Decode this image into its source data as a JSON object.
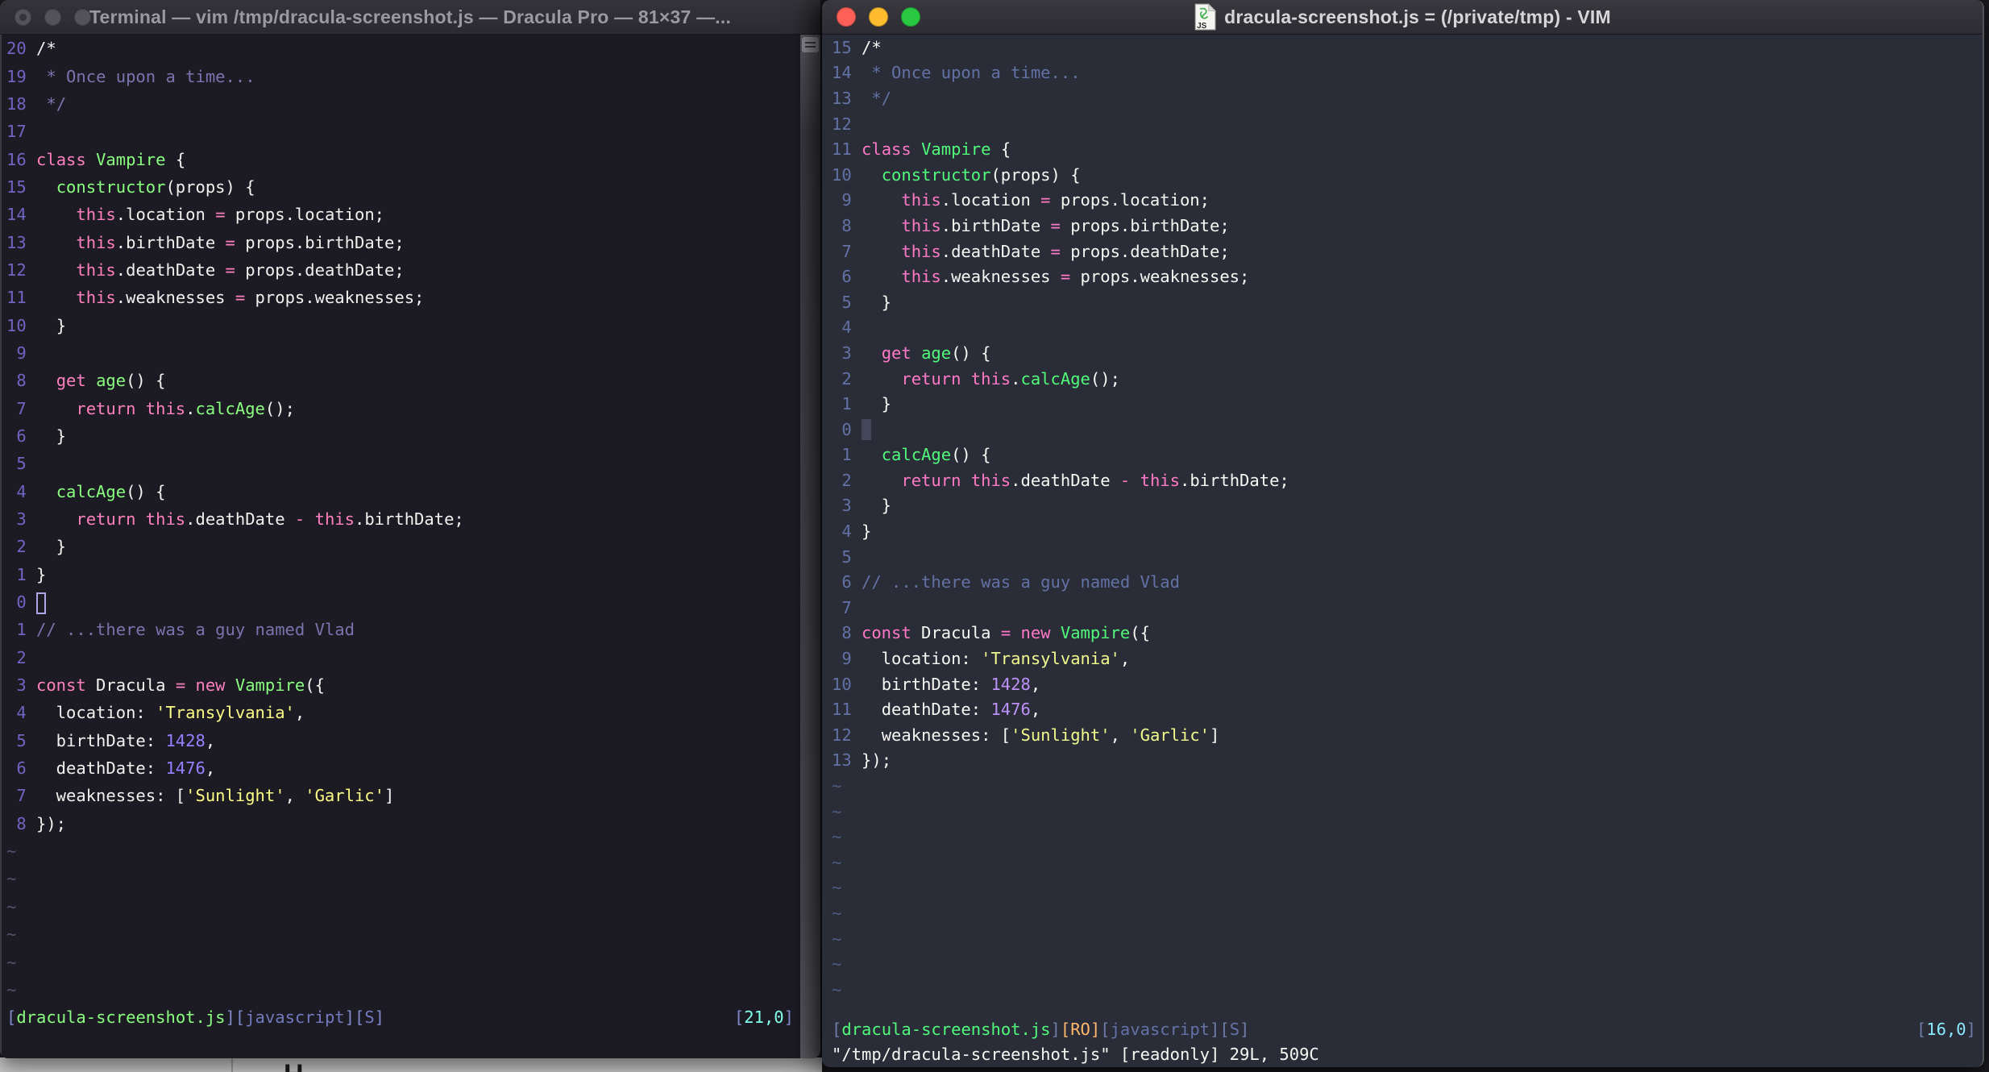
{
  "left_window": {
    "title": "Terminal — vim /tmp/dracula-screenshot.js — Dracula Pro — 81×37 —...",
    "traffic_lights": [
      "close",
      "minimize",
      "zoom"
    ],
    "line_numbers": [
      "20",
      "19",
      "18",
      "17",
      "16",
      "15",
      "14",
      "13",
      "12",
      "11",
      "10",
      "9",
      "8",
      "7",
      "6",
      "5",
      "4",
      "3",
      "2",
      "1",
      "0",
      "1",
      "2",
      "3",
      "4",
      "5",
      "6",
      "7",
      "8"
    ],
    "tilde_rows": 6,
    "cursor_row_index": 20,
    "cursor_style": "hollow",
    "status_left_spans": [
      [
        "sb",
        "["
      ],
      [
        "sfile",
        "dracula-screenshot.js"
      ],
      [
        "sb",
        "]["
      ],
      [
        "sflag",
        "javascript"
      ],
      [
        "sb",
        "]["
      ],
      [
        "sflag",
        "S"
      ],
      [
        "sb",
        "]"
      ]
    ],
    "status_right_spans": [
      [
        "sb",
        "["
      ],
      [
        "spos",
        "21,0"
      ],
      [
        "sb",
        "]"
      ]
    ],
    "command_line": "",
    "palette": {
      "background": "#1c1b24",
      "foreground": "#f2f1ee",
      "comment": "#7a74ae",
      "pink": "#ff80bf",
      "green": "#8aff80",
      "purple": "#9580ff",
      "yellow": "#fdfd85",
      "cyan": "#80ffea",
      "line_number": "#7064c2"
    }
  },
  "right_window": {
    "title": "dracula-screenshot.js = (/private/tmp) - VIM",
    "doc_icon_label": "JS",
    "traffic_lights": [
      "close",
      "minimize",
      "zoom"
    ],
    "line_numbers": [
      "15",
      "14",
      "13",
      "12",
      "11",
      "10",
      "9",
      "8",
      "7",
      "6",
      "5",
      "4",
      "3",
      "2",
      "1",
      "0",
      "1",
      "2",
      "3",
      "4",
      "5",
      "6",
      "7",
      "8",
      "9",
      "10",
      "11",
      "12",
      "13"
    ],
    "tilde_rows": 9,
    "cursor_row_index": 15,
    "cursor_style": "block",
    "status_left_spans": [
      [
        "sb",
        "["
      ],
      [
        "sfile",
        "dracula-screenshot.js"
      ],
      [
        "sb",
        "]"
      ],
      [
        "sro",
        "[RO]"
      ],
      [
        "sb",
        "["
      ],
      [
        "sflag",
        "javascript"
      ],
      [
        "sb",
        "]["
      ],
      [
        "sflag",
        "S"
      ],
      [
        "sb",
        "]"
      ]
    ],
    "status_right_spans": [
      [
        "sb",
        "["
      ],
      [
        "spos",
        "16,0"
      ],
      [
        "sb",
        "]"
      ]
    ],
    "command_line": "\"/tmp/dracula-screenshot.js\" [readonly] 29L, 509C",
    "palette": {
      "background": "#2a2c38",
      "foreground": "#f8f8f2",
      "comment": "#6272a4",
      "pink": "#ff79c6",
      "green": "#50fa7b",
      "purple": "#bd93f9",
      "yellow": "#f1fa8c",
      "cyan": "#8be9fd",
      "orange": "#ffb86c",
      "line_number": "#6272a4"
    }
  },
  "code_lines": [
    {
      "spans": [
        [
          "fg",
          "/*"
        ]
      ]
    },
    {
      "spans": [
        [
          "comment",
          " * Once upon a time..."
        ]
      ]
    },
    {
      "spans": [
        [
          "comment",
          " */"
        ]
      ]
    },
    {
      "spans": []
    },
    {
      "spans": [
        [
          "pink",
          "class"
        ],
        [
          "fg",
          " "
        ],
        [
          "green",
          "Vampire"
        ],
        [
          "fg",
          " {"
        ]
      ]
    },
    {
      "spans": [
        [
          "fg",
          "  "
        ],
        [
          "green",
          "constructor"
        ],
        [
          "fg",
          "(props) {"
        ]
      ]
    },
    {
      "spans": [
        [
          "fg",
          "    "
        ],
        [
          "pink",
          "this"
        ],
        [
          "fg",
          ".location "
        ],
        [
          "pink",
          "="
        ],
        [
          "fg",
          " props.location;"
        ]
      ]
    },
    {
      "spans": [
        [
          "fg",
          "    "
        ],
        [
          "pink",
          "this"
        ],
        [
          "fg",
          ".birthDate "
        ],
        [
          "pink",
          "="
        ],
        [
          "fg",
          " props.birthDate;"
        ]
      ]
    },
    {
      "spans": [
        [
          "fg",
          "    "
        ],
        [
          "pink",
          "this"
        ],
        [
          "fg",
          ".deathDate "
        ],
        [
          "pink",
          "="
        ],
        [
          "fg",
          " props.deathDate;"
        ]
      ]
    },
    {
      "spans": [
        [
          "fg",
          "    "
        ],
        [
          "pink",
          "this"
        ],
        [
          "fg",
          ".weaknesses "
        ],
        [
          "pink",
          "="
        ],
        [
          "fg",
          " props.weaknesses;"
        ]
      ]
    },
    {
      "spans": [
        [
          "fg",
          "  }"
        ]
      ]
    },
    {
      "spans": []
    },
    {
      "spans": [
        [
          "fg",
          "  "
        ],
        [
          "pink",
          "get"
        ],
        [
          "fg",
          " "
        ],
        [
          "green",
          "age"
        ],
        [
          "fg",
          "() {"
        ]
      ]
    },
    {
      "spans": [
        [
          "fg",
          "    "
        ],
        [
          "pink",
          "return"
        ],
        [
          "fg",
          " "
        ],
        [
          "pink",
          "this"
        ],
        [
          "fg",
          "."
        ],
        [
          "green",
          "calcAge"
        ],
        [
          "fg",
          "();"
        ]
      ]
    },
    {
      "spans": [
        [
          "fg",
          "  }"
        ]
      ]
    },
    {
      "spans": []
    },
    {
      "spans": [
        [
          "fg",
          "  "
        ],
        [
          "green",
          "calcAge"
        ],
        [
          "fg",
          "() {"
        ]
      ]
    },
    {
      "spans": [
        [
          "fg",
          "    "
        ],
        [
          "pink",
          "return"
        ],
        [
          "fg",
          " "
        ],
        [
          "pink",
          "this"
        ],
        [
          "fg",
          ".deathDate "
        ],
        [
          "pink",
          "-"
        ],
        [
          "fg",
          " "
        ],
        [
          "pink",
          "this"
        ],
        [
          "fg",
          ".birthDate;"
        ]
      ]
    },
    {
      "spans": [
        [
          "fg",
          "  }"
        ]
      ]
    },
    {
      "spans": [
        [
          "fg",
          "}"
        ]
      ]
    },
    {
      "spans": []
    },
    {
      "spans": [
        [
          "comment",
          "// ...there was a guy named Vlad"
        ]
      ]
    },
    {
      "spans": []
    },
    {
      "spans": [
        [
          "pink",
          "const"
        ],
        [
          "fg",
          " Dracula "
        ],
        [
          "pink",
          "="
        ],
        [
          "fg",
          " "
        ],
        [
          "pink",
          "new"
        ],
        [
          "fg",
          " "
        ],
        [
          "green",
          "Vampire"
        ],
        [
          "fg",
          "({"
        ]
      ]
    },
    {
      "spans": [
        [
          "fg",
          "  location: "
        ],
        [
          "yellow",
          "'Transylvania'"
        ],
        [
          "fg",
          ","
        ]
      ]
    },
    {
      "spans": [
        [
          "fg",
          "  birthDate: "
        ],
        [
          "purple",
          "1428"
        ],
        [
          "fg",
          ","
        ]
      ]
    },
    {
      "spans": [
        [
          "fg",
          "  deathDate: "
        ],
        [
          "purple",
          "1476"
        ],
        [
          "fg",
          ","
        ]
      ]
    },
    {
      "spans": [
        [
          "fg",
          "  weaknesses: ["
        ],
        [
          "yellow",
          "'Sunlight'"
        ],
        [
          "fg",
          ", "
        ],
        [
          "yellow",
          "'Garlic'"
        ],
        [
          "fg",
          "]"
        ]
      ]
    },
    {
      "spans": [
        [
          "fg",
          "});"
        ]
      ]
    }
  ],
  "bottom_strip": {
    "partial_glyph": "H"
  }
}
